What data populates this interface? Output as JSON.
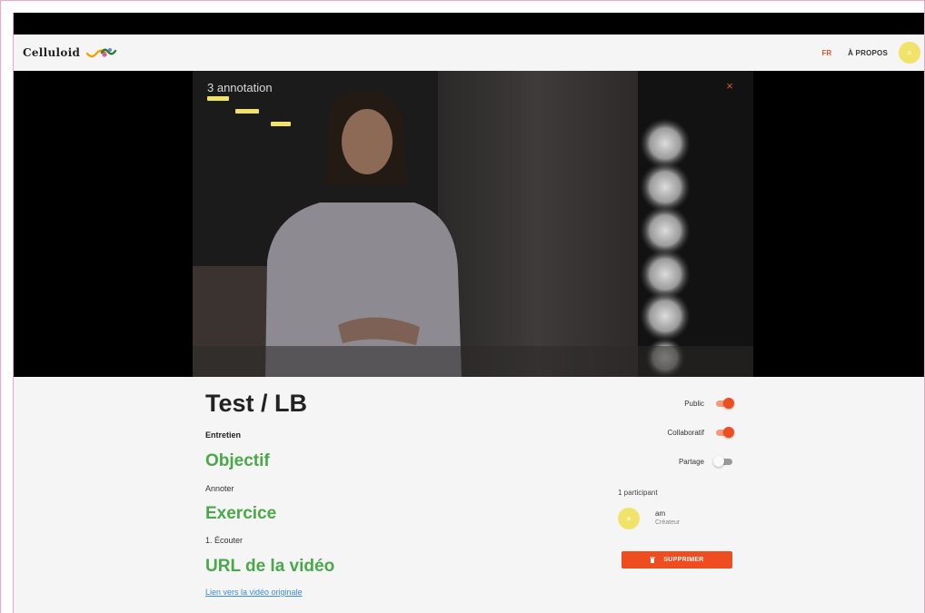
{
  "header": {
    "logo_text": "Celluloid",
    "lang": "FR",
    "about": "À PROPOS",
    "user_initials": "a"
  },
  "player": {
    "annotation_count": "3 annotation",
    "close_symbol": "×",
    "annotation_bars": 3,
    "accent_color": "#f1e26a"
  },
  "project": {
    "title": "Test / LB",
    "category": "Entretien",
    "objective_heading": "Objectif",
    "objective_text": "Annoter",
    "exercise_heading": "Exercice",
    "exercise_text": "1. Écouter",
    "url_heading": "URL de la vidéo",
    "url_link": "Lien vers la vidéo originale"
  },
  "settings": {
    "toggles": [
      {
        "label": "Public",
        "on": true
      },
      {
        "label": "Collaboratif",
        "on": true
      },
      {
        "label": "Partage",
        "on": false
      }
    ]
  },
  "participants": {
    "count_label": "1 participant",
    "list": [
      {
        "initials": "a",
        "name": "am",
        "role": "Créateur"
      }
    ]
  },
  "actions": {
    "delete_label": "SUPPRIMER",
    "delete_color": "#ef4c1f"
  },
  "icons": {
    "logo": "celluloid-logo-icon",
    "close": "close-icon",
    "trash": "trash-icon"
  }
}
